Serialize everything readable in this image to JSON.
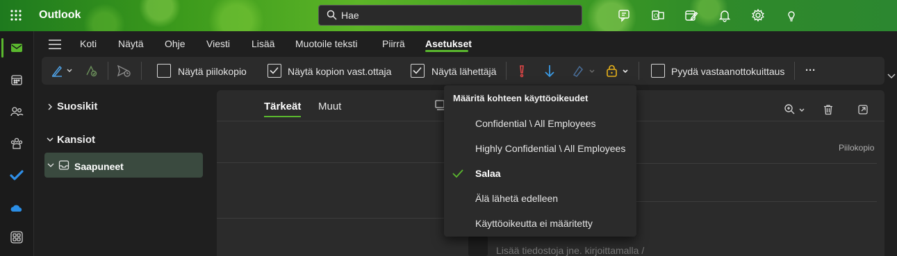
{
  "app": {
    "title": "Outlook"
  },
  "search": {
    "placeholder": "Hae"
  },
  "colors": {
    "accent": "#5ab82e",
    "header_start": "#1e7a1e",
    "header_end": "#2c8730",
    "important": "#e04646",
    "low_importance": "#3b9be5",
    "lock": "#e8b21a"
  },
  "header_icons": [
    "teams-chat-icon",
    "office-apps-icon",
    "my-day-icon",
    "bell-icon",
    "gear-icon",
    "lightbulb-icon"
  ],
  "rail_icons": [
    "mail-icon",
    "calendar-icon",
    "people-icon",
    "groups-icon",
    "todo-icon",
    "onedrive-icon",
    "apps-icon"
  ],
  "ribbon": {
    "tabs": [
      "Koti",
      "Näytä",
      "Ohje",
      "Viesti",
      "Lisää",
      "Muotoile teksti",
      "Piirrä",
      "Asetukset"
    ],
    "active_tab": "Asetukset"
  },
  "commands": {
    "show_bcc": {
      "label": "Näytä piilokopio",
      "checked": false
    },
    "show_from_copy": {
      "label": "Näytä kopion vast.ottaja",
      "checked": true
    },
    "show_from": {
      "label": "Näytä lähettäjä",
      "checked": true
    },
    "request_receipt": {
      "label": "Pyydä vastaanottokuittaus",
      "checked": false
    },
    "more": "···"
  },
  "folders": {
    "favorites": "Suosikit",
    "folders": "Kansiot",
    "inbox": "Saapuneet"
  },
  "message_list": {
    "tabs": [
      "Tärkeät",
      "Muut"
    ],
    "active_tab": "Tärkeät"
  },
  "compose": {
    "bcc_label": "Piilokopio",
    "body_placeholder": "Lisää tiedostoja jne. kirjoittamalla /"
  },
  "permissions_menu": {
    "header": "Määritä kohteen käyttöoikeudet",
    "items": [
      {
        "label": "Confidential \\ All Employees",
        "selected": false,
        "bold": false
      },
      {
        "label": "Highly Confidential \\ All Employees",
        "selected": false,
        "bold": false
      },
      {
        "label": "Salaa",
        "selected": true,
        "bold": true
      },
      {
        "label": "Älä lähetä edelleen",
        "selected": false,
        "bold": false
      },
      {
        "label": "Käyttöoikeutta ei määritetty",
        "selected": false,
        "bold": false
      }
    ]
  }
}
